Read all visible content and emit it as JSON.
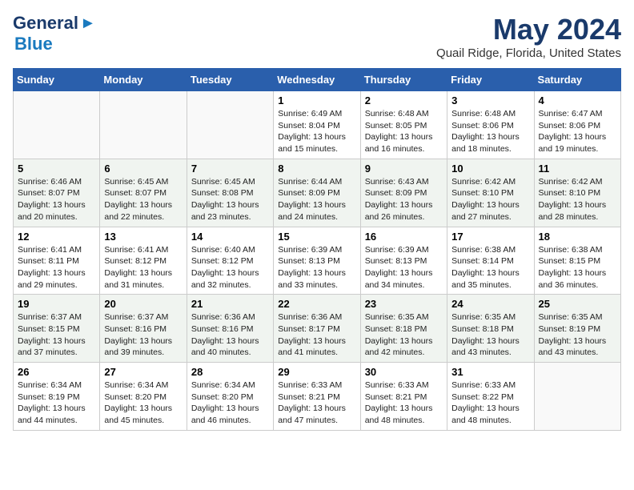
{
  "header": {
    "logo_general": "General",
    "logo_blue": "Blue",
    "month_title": "May 2024",
    "location": "Quail Ridge, Florida, United States"
  },
  "weekdays": [
    "Sunday",
    "Monday",
    "Tuesday",
    "Wednesday",
    "Thursday",
    "Friday",
    "Saturday"
  ],
  "weeks": [
    [
      {
        "day": "",
        "info": ""
      },
      {
        "day": "",
        "info": ""
      },
      {
        "day": "",
        "info": ""
      },
      {
        "day": "1",
        "info": "Sunrise: 6:49 AM\nSunset: 8:04 PM\nDaylight: 13 hours\nand 15 minutes."
      },
      {
        "day": "2",
        "info": "Sunrise: 6:48 AM\nSunset: 8:05 PM\nDaylight: 13 hours\nand 16 minutes."
      },
      {
        "day": "3",
        "info": "Sunrise: 6:48 AM\nSunset: 8:06 PM\nDaylight: 13 hours\nand 18 minutes."
      },
      {
        "day": "4",
        "info": "Sunrise: 6:47 AM\nSunset: 8:06 PM\nDaylight: 13 hours\nand 19 minutes."
      }
    ],
    [
      {
        "day": "5",
        "info": "Sunrise: 6:46 AM\nSunset: 8:07 PM\nDaylight: 13 hours\nand 20 minutes."
      },
      {
        "day": "6",
        "info": "Sunrise: 6:45 AM\nSunset: 8:07 PM\nDaylight: 13 hours\nand 22 minutes."
      },
      {
        "day": "7",
        "info": "Sunrise: 6:45 AM\nSunset: 8:08 PM\nDaylight: 13 hours\nand 23 minutes."
      },
      {
        "day": "8",
        "info": "Sunrise: 6:44 AM\nSunset: 8:09 PM\nDaylight: 13 hours\nand 24 minutes."
      },
      {
        "day": "9",
        "info": "Sunrise: 6:43 AM\nSunset: 8:09 PM\nDaylight: 13 hours\nand 26 minutes."
      },
      {
        "day": "10",
        "info": "Sunrise: 6:42 AM\nSunset: 8:10 PM\nDaylight: 13 hours\nand 27 minutes."
      },
      {
        "day": "11",
        "info": "Sunrise: 6:42 AM\nSunset: 8:10 PM\nDaylight: 13 hours\nand 28 minutes."
      }
    ],
    [
      {
        "day": "12",
        "info": "Sunrise: 6:41 AM\nSunset: 8:11 PM\nDaylight: 13 hours\nand 29 minutes."
      },
      {
        "day": "13",
        "info": "Sunrise: 6:41 AM\nSunset: 8:12 PM\nDaylight: 13 hours\nand 31 minutes."
      },
      {
        "day": "14",
        "info": "Sunrise: 6:40 AM\nSunset: 8:12 PM\nDaylight: 13 hours\nand 32 minutes."
      },
      {
        "day": "15",
        "info": "Sunrise: 6:39 AM\nSunset: 8:13 PM\nDaylight: 13 hours\nand 33 minutes."
      },
      {
        "day": "16",
        "info": "Sunrise: 6:39 AM\nSunset: 8:13 PM\nDaylight: 13 hours\nand 34 minutes."
      },
      {
        "day": "17",
        "info": "Sunrise: 6:38 AM\nSunset: 8:14 PM\nDaylight: 13 hours\nand 35 minutes."
      },
      {
        "day": "18",
        "info": "Sunrise: 6:38 AM\nSunset: 8:15 PM\nDaylight: 13 hours\nand 36 minutes."
      }
    ],
    [
      {
        "day": "19",
        "info": "Sunrise: 6:37 AM\nSunset: 8:15 PM\nDaylight: 13 hours\nand 37 minutes."
      },
      {
        "day": "20",
        "info": "Sunrise: 6:37 AM\nSunset: 8:16 PM\nDaylight: 13 hours\nand 39 minutes."
      },
      {
        "day": "21",
        "info": "Sunrise: 6:36 AM\nSunset: 8:16 PM\nDaylight: 13 hours\nand 40 minutes."
      },
      {
        "day": "22",
        "info": "Sunrise: 6:36 AM\nSunset: 8:17 PM\nDaylight: 13 hours\nand 41 minutes."
      },
      {
        "day": "23",
        "info": "Sunrise: 6:35 AM\nSunset: 8:18 PM\nDaylight: 13 hours\nand 42 minutes."
      },
      {
        "day": "24",
        "info": "Sunrise: 6:35 AM\nSunset: 8:18 PM\nDaylight: 13 hours\nand 43 minutes."
      },
      {
        "day": "25",
        "info": "Sunrise: 6:35 AM\nSunset: 8:19 PM\nDaylight: 13 hours\nand 43 minutes."
      }
    ],
    [
      {
        "day": "26",
        "info": "Sunrise: 6:34 AM\nSunset: 8:19 PM\nDaylight: 13 hours\nand 44 minutes."
      },
      {
        "day": "27",
        "info": "Sunrise: 6:34 AM\nSunset: 8:20 PM\nDaylight: 13 hours\nand 45 minutes."
      },
      {
        "day": "28",
        "info": "Sunrise: 6:34 AM\nSunset: 8:20 PM\nDaylight: 13 hours\nand 46 minutes."
      },
      {
        "day": "29",
        "info": "Sunrise: 6:33 AM\nSunset: 8:21 PM\nDaylight: 13 hours\nand 47 minutes."
      },
      {
        "day": "30",
        "info": "Sunrise: 6:33 AM\nSunset: 8:21 PM\nDaylight: 13 hours\nand 48 minutes."
      },
      {
        "day": "31",
        "info": "Sunrise: 6:33 AM\nSunset: 8:22 PM\nDaylight: 13 hours\nand 48 minutes."
      },
      {
        "day": "",
        "info": ""
      }
    ]
  ]
}
